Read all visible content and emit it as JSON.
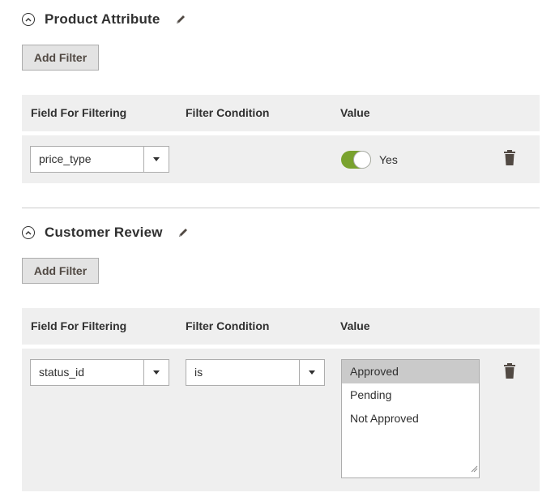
{
  "sections": [
    {
      "title": "Product Attribute",
      "add_filter_label": "Add Filter",
      "columns": [
        "Field For Filtering",
        "Filter Condition",
        "Value"
      ],
      "row": {
        "field": "price_type",
        "toggle_on": true,
        "toggle_label": "Yes"
      }
    },
    {
      "title": "Customer Review",
      "add_filter_label": "Add Filter",
      "columns": [
        "Field For Filtering",
        "Filter Condition",
        "Value"
      ],
      "row": {
        "field": "status_id",
        "condition": "is",
        "options": [
          "Approved",
          "Pending",
          "Not Approved"
        ],
        "selected": "Approved"
      }
    }
  ],
  "icons": {
    "collapse": "circle-chevron-up-icon",
    "edit": "pencil-icon",
    "dropdown": "caret-down-icon",
    "delete": "trash-icon"
  },
  "colors": {
    "toggle_on": "#79a22e",
    "header_bg": "#efefef",
    "button_bg": "#e3e3e3",
    "selected_option": "#cacaca"
  }
}
